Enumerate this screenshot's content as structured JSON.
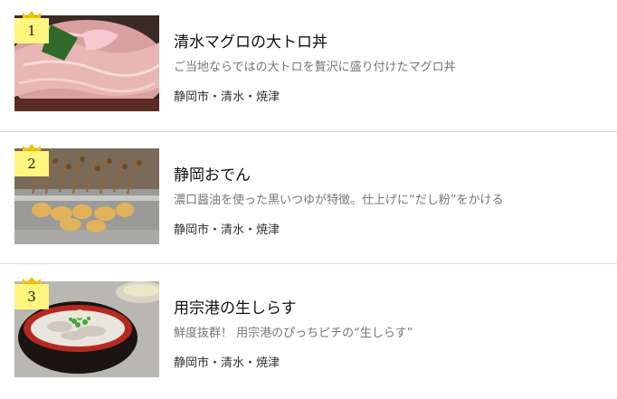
{
  "items": [
    {
      "rank": "1",
      "title": "清水マグロの大トロ丼",
      "description": "ご当地ならではの大トロを贅沢に盛り付けたマグロ丼",
      "tags": "静岡市・清水・焼津",
      "image": "tuna-bowl-photo"
    },
    {
      "rank": "2",
      "title": "静岡おでん",
      "description": "濃口醤油を使った黒いつゆが特徴。仕上げに“だし粉”をかける",
      "tags": "静岡市・清水・焼津",
      "image": "oden-photo"
    },
    {
      "rank": "3",
      "title": "用宗港の生しらす",
      "description": "鮮度抜群！ 用宗港のぴっちピチの“生しらす”",
      "tags": "静岡市・清水・焼津",
      "image": "shirasu-bowl-photo"
    }
  ],
  "colors": {
    "rank_badge": "#fff57f",
    "crown": "#f2c200",
    "divider": "#d8d8d8",
    "description_text": "#777777"
  }
}
